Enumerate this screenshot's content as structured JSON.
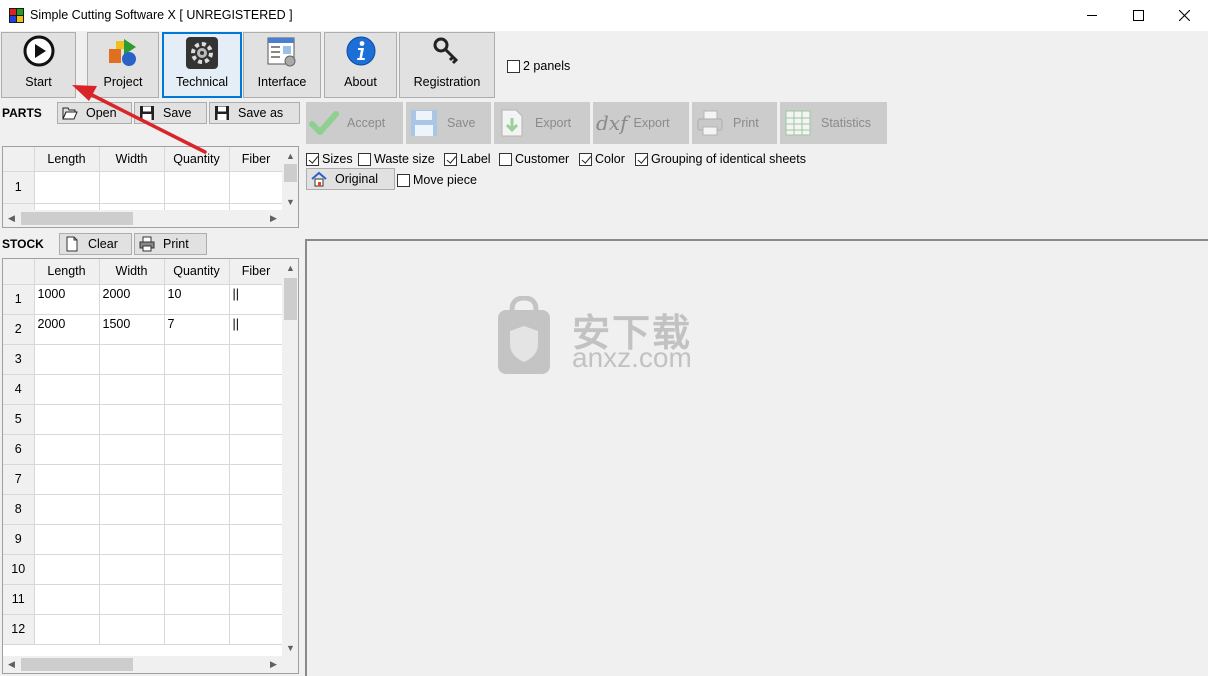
{
  "window": {
    "title": "Simple Cutting Software X [ UNREGISTERED ]",
    "minimize_icon": "minimize-icon",
    "maximize_icon": "maximize-icon",
    "close_icon": "close-icon"
  },
  "toolbar": {
    "buttons": [
      {
        "label": "Start",
        "icon": "play-icon"
      },
      {
        "label": "Project",
        "icon": "shapes-icon"
      },
      {
        "label": "Technical",
        "icon": "gear-icon",
        "selected": true
      },
      {
        "label": "Interface",
        "icon": "layout-icon"
      },
      {
        "label": "About",
        "icon": "info-icon"
      },
      {
        "label": "Registration",
        "icon": "key-icon"
      }
    ],
    "two_panels": {
      "label": "2 panels",
      "checked": false
    }
  },
  "parts": {
    "title": "PARTS",
    "open_label": "Open",
    "save_label": "Save",
    "save_as_label": "Save as",
    "columns": [
      "Length",
      "Width",
      "Quantity",
      "Fiber"
    ],
    "rows": [
      {
        "num": "1",
        "cells": [
          "",
          "",
          "",
          ""
        ]
      }
    ]
  },
  "stock": {
    "title": "STOCK",
    "clear_label": "Clear",
    "print_label": "Print",
    "columns": [
      "Length",
      "Width",
      "Quantity",
      "Fiber"
    ],
    "rows": [
      {
        "num": "1",
        "cells": [
          "1000",
          "2000",
          "10",
          "||"
        ]
      },
      {
        "num": "2",
        "cells": [
          "2000",
          "1500",
          "7",
          "||"
        ]
      },
      {
        "num": "3",
        "cells": [
          "",
          "",
          "",
          ""
        ]
      },
      {
        "num": "4",
        "cells": [
          "",
          "",
          "",
          ""
        ]
      },
      {
        "num": "5",
        "cells": [
          "",
          "",
          "",
          ""
        ]
      },
      {
        "num": "6",
        "cells": [
          "",
          "",
          "",
          ""
        ]
      },
      {
        "num": "7",
        "cells": [
          "",
          "",
          "",
          ""
        ]
      },
      {
        "num": "8",
        "cells": [
          "",
          "",
          "",
          ""
        ]
      },
      {
        "num": "9",
        "cells": [
          "",
          "",
          "",
          ""
        ]
      },
      {
        "num": "10",
        "cells": [
          "",
          "",
          "",
          ""
        ]
      },
      {
        "num": "11",
        "cells": [
          "",
          "",
          "",
          ""
        ]
      },
      {
        "num": "12",
        "cells": [
          "",
          "",
          "",
          ""
        ]
      }
    ]
  },
  "result_toolbar": {
    "accept_label": "Accept",
    "save_label": "Save",
    "export_label": "Export",
    "dxf_label": "dxf",
    "export_dxf_label": "Export",
    "print_label": "Print",
    "statistics_label": "Statistics"
  },
  "options": {
    "sizes": {
      "label": "Sizes",
      "checked": true
    },
    "waste_size": {
      "label": "Waste size",
      "checked": false
    },
    "label": {
      "label": "Label",
      "checked": true
    },
    "customer": {
      "label": "Customer",
      "checked": false
    },
    "color": {
      "label": "Color",
      "checked": true
    },
    "grouping": {
      "label": "Grouping of identical sheets",
      "checked": true
    },
    "original_label": "Original",
    "move_piece": {
      "label": "Move piece",
      "checked": false
    }
  },
  "watermark": {
    "text": "安下载",
    "url": "anxz.com"
  },
  "annotation": {
    "arrow_color": "#d9252a"
  }
}
